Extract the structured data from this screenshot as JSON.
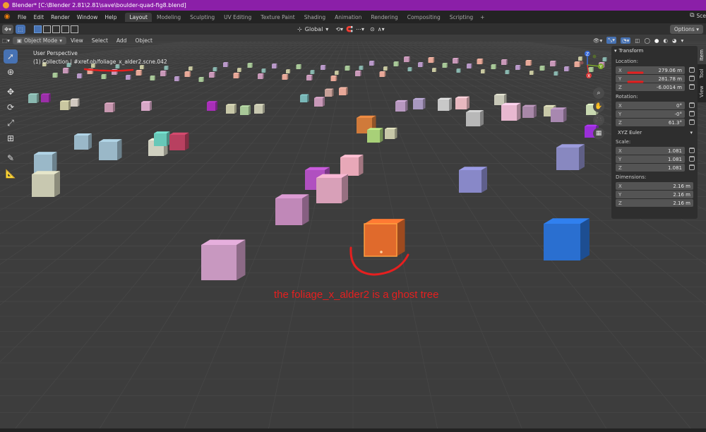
{
  "window_title": "Blender* [C:\\Blender 2.81\\2.81\\save\\boulder-quad-fig8.blend]",
  "menu": [
    "File",
    "Edit",
    "Render",
    "Window",
    "Help"
  ],
  "workspaces": [
    {
      "label": "Layout",
      "active": true
    },
    {
      "label": "Modeling",
      "active": false
    },
    {
      "label": "Sculpting",
      "active": false
    },
    {
      "label": "UV Editing",
      "active": false
    },
    {
      "label": "Texture Paint",
      "active": false
    },
    {
      "label": "Shading",
      "active": false
    },
    {
      "label": "Animation",
      "active": false
    },
    {
      "label": "Rendering",
      "active": false
    },
    {
      "label": "Compositing",
      "active": false
    },
    {
      "label": "Scripting",
      "active": false
    }
  ],
  "scene_label": "Sce",
  "toolheader": {
    "orientation": "Global",
    "options_label": "Options"
  },
  "viewport_header": {
    "mode": "Object Mode",
    "menus": [
      "View",
      "Select",
      "Add",
      "Object"
    ]
  },
  "viewport": {
    "perspective": "User Perspective",
    "collection": "(1) Collection | #xref.ob/foliage_x_alder2.scne.042"
  },
  "transform": {
    "title": "Transform",
    "location_label": "Location:",
    "location": [
      {
        "axis": "X",
        "value": "279.06 m"
      },
      {
        "axis": "Y",
        "value": "281.78 m"
      },
      {
        "axis": "Z",
        "value": "-6.0014 m"
      }
    ],
    "rotation_label": "Rotation:",
    "rotation": [
      {
        "axis": "X",
        "value": "0°"
      },
      {
        "axis": "Y",
        "value": "-0°"
      },
      {
        "axis": "Z",
        "value": "61.3°"
      }
    ],
    "rotation_mode": "XYZ Euler",
    "scale_label": "Scale:",
    "scale": [
      {
        "axis": "X",
        "value": "1.081"
      },
      {
        "axis": "Y",
        "value": "1.081"
      },
      {
        "axis": "Z",
        "value": "1.081"
      }
    ],
    "dimensions_label": "Dimensions:",
    "dimensions": [
      {
        "axis": "X",
        "value": "2.16 m"
      },
      {
        "axis": "Y",
        "value": "2.16 m"
      },
      {
        "axis": "Z",
        "value": "2.16 m"
      }
    ]
  },
  "side_tabs": [
    "Item",
    "Tool",
    "View"
  ],
  "gizmo_axes": [
    "Z",
    "Y",
    "X"
  ],
  "annotation": "the foliage_x_alder2 is a ghost tree",
  "colors": {
    "title_bar": "#8b1fa8",
    "accent_blue": "#4772b3",
    "annotation_red": "#e61f1f",
    "selected_cube": "#e06a2c"
  }
}
